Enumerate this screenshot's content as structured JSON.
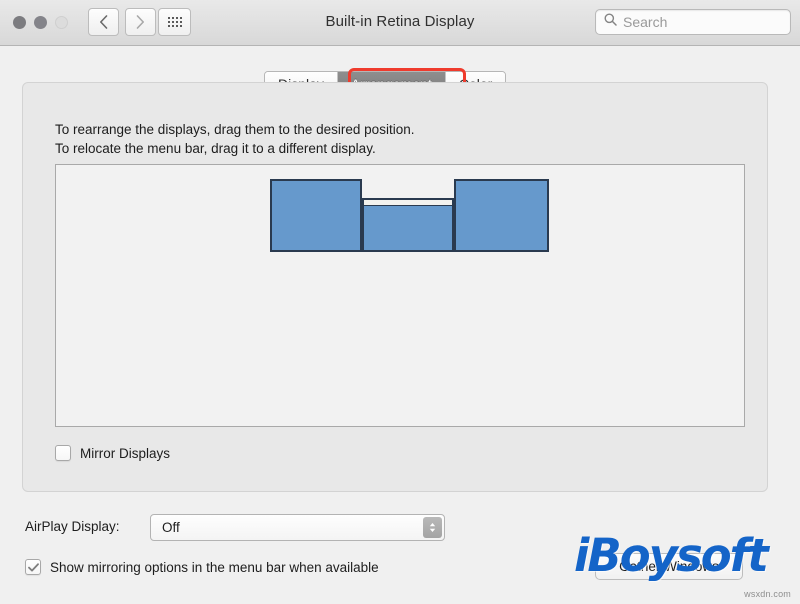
{
  "window": {
    "title": "Built-in Retina Display",
    "traffic_lights": [
      "close",
      "minimize",
      "zoom"
    ]
  },
  "toolbar": {
    "back_icon": "chevron-left-icon",
    "forward_icon": "chevron-right-icon",
    "grid_icon": "show-all-grid-icon",
    "search": {
      "icon": "search-icon",
      "placeholder": "Search",
      "value": ""
    }
  },
  "tabs": [
    {
      "label": "Display",
      "active": false
    },
    {
      "label": "Arrangement",
      "active": true
    },
    {
      "label": "Color",
      "active": false
    }
  ],
  "highlight": {
    "target": "Arrangement",
    "color": "#ef3b2d"
  },
  "panel": {
    "instructions": [
      "To rearrange the displays, drag them to the desired position.",
      "To relocate the menu bar, drag it to a different display."
    ],
    "displays": [
      {
        "name": "display-left",
        "has_menu_bar": false,
        "color": "#6699cc"
      },
      {
        "name": "display-middle",
        "has_menu_bar": true,
        "color": "#6699cc"
      },
      {
        "name": "display-right",
        "has_menu_bar": false,
        "color": "#6699cc"
      }
    ],
    "mirror_displays": {
      "label": "Mirror Displays",
      "checked": false
    }
  },
  "bottom": {
    "airplay_label": "AirPlay Display:",
    "airplay_value": "Off",
    "airplay_options": [
      "Off"
    ],
    "show_mirroring": {
      "label": "Show mirroring options in the menu bar when available",
      "checked": true
    },
    "gather_windows_label": "Gather Windows"
  },
  "watermark": {
    "brand": "iBoysoft",
    "site": "wsxdn.com",
    "color": "#1464c8"
  }
}
